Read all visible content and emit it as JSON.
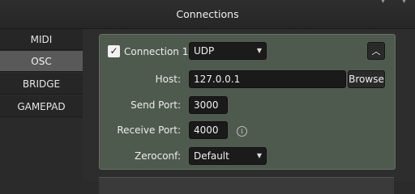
{
  "window": {
    "title": "Connections"
  },
  "sidebar": {
    "items": [
      {
        "label": "MIDI",
        "active": false
      },
      {
        "label": "OSC",
        "active": true
      },
      {
        "label": "BRIDGE",
        "active": false
      },
      {
        "label": "GAMEPAD",
        "active": false
      }
    ]
  },
  "connection": {
    "enabled": true,
    "checkbox_icon": "check-icon",
    "name": "Connection 1",
    "protocol": "UDP",
    "collapse_icon": "chevron-up-icon",
    "host": {
      "label": "Host:",
      "value": "127.0.0.1",
      "browse_label": "Browse"
    },
    "send_port": {
      "label": "Send Port:",
      "value": "3000"
    },
    "receive_port": {
      "label": "Receive Port:",
      "value": "4000",
      "info_icon": "info-icon"
    },
    "zeroconf": {
      "label": "Zeroconf:",
      "value": "Default"
    }
  },
  "colors": {
    "panel": "#4f5a4e",
    "sidebar_active": "#595959",
    "field_bg": "#1a1a1a"
  }
}
